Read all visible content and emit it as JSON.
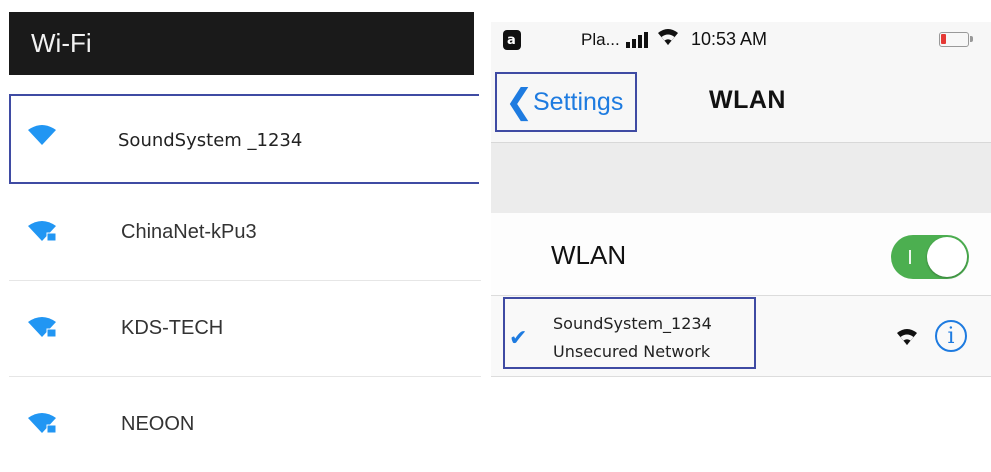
{
  "android": {
    "title": "Wi-Fi",
    "networks": [
      {
        "name": "SoundSystem _1234",
        "selected": true
      },
      {
        "name": "ChinaNet-kPu3",
        "selected": false
      },
      {
        "name": "KDS-TECH",
        "selected": false
      },
      {
        "name": "NEOON",
        "selected": false
      }
    ],
    "colors": {
      "header": "#1a1a1a",
      "wifi_icon": "#2196f3",
      "highlight": "#3f4ba3"
    }
  },
  "ios": {
    "status": {
      "lock_glyph": "a",
      "carrier": "Pla...",
      "time": "10:53 AM",
      "battery_level": 0.2
    },
    "nav": {
      "back_chevron": "❮",
      "back_label": "Settings",
      "title": "WLAN"
    },
    "wlan_toggle": {
      "label": "WLAN",
      "on": true
    },
    "connected_network": {
      "check": "✔",
      "name": "SoundSystem_1234",
      "subtitle": "Unsecured Network",
      "info_glyph": "i"
    },
    "colors": {
      "accent": "#1e7be0",
      "toggle_on": "#4caf50",
      "battery_low": "#e53935"
    }
  }
}
